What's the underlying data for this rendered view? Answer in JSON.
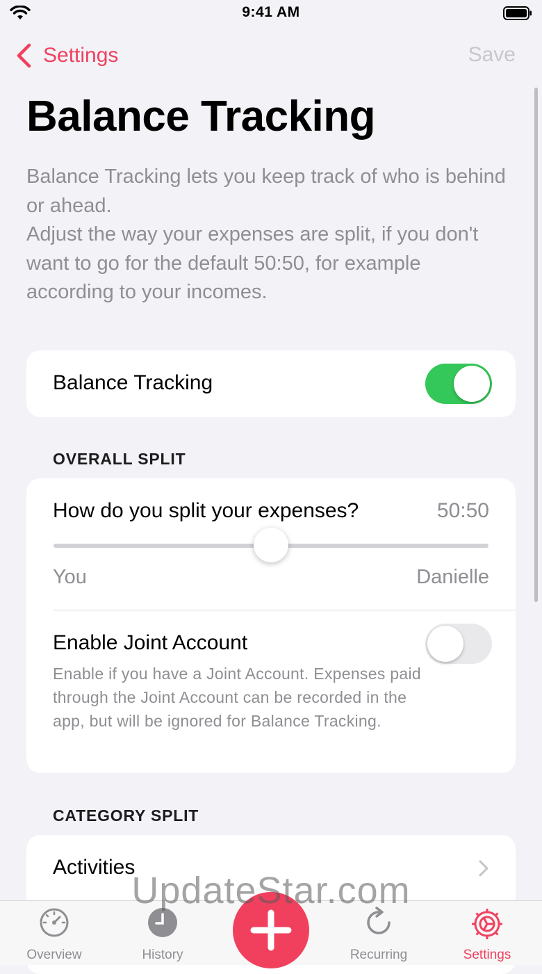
{
  "status_bar": {
    "time": "9:41 AM"
  },
  "nav": {
    "back_label": "Settings",
    "save_label": "Save"
  },
  "page": {
    "title": "Balance Tracking",
    "intro": [
      "Balance Tracking lets you keep track of who is behind or ahead.",
      "Adjust the way your expenses are split, if you don't want to go for the default 50:50, for example according to your incomes."
    ]
  },
  "balance_tracking": {
    "label": "Balance Tracking",
    "enabled": true
  },
  "overall_split": {
    "header": "OVERALL SPLIT",
    "question": "How do you split your expenses?",
    "value": "50:50",
    "slider_level": 0.5,
    "left_label": "You",
    "right_label": "Danielle",
    "joint_account": {
      "label": "Enable Joint Account",
      "enabled": false,
      "description": "Enable if you have a Joint Account. Expenses paid through the Joint Account can be recorded in the app, but will be ignored for Balance Tracking."
    }
  },
  "category_split": {
    "header": "CATEGORY SPLIT",
    "items": [
      {
        "label": "Activities"
      }
    ]
  },
  "tabbar": {
    "tabs": [
      {
        "label": "Overview",
        "icon": "gauge-icon"
      },
      {
        "label": "History",
        "icon": "clock-icon"
      },
      {
        "label": "Recurring",
        "icon": "refresh-icon"
      },
      {
        "label": "Settings",
        "icon": "gear-icon",
        "active": true
      }
    ],
    "add_icon": "plus-icon"
  },
  "watermark": "UpdateStar.com",
  "colors": {
    "accent": "#f0405e",
    "toggle_on": "#34c759",
    "background": "#f2f2f7"
  }
}
